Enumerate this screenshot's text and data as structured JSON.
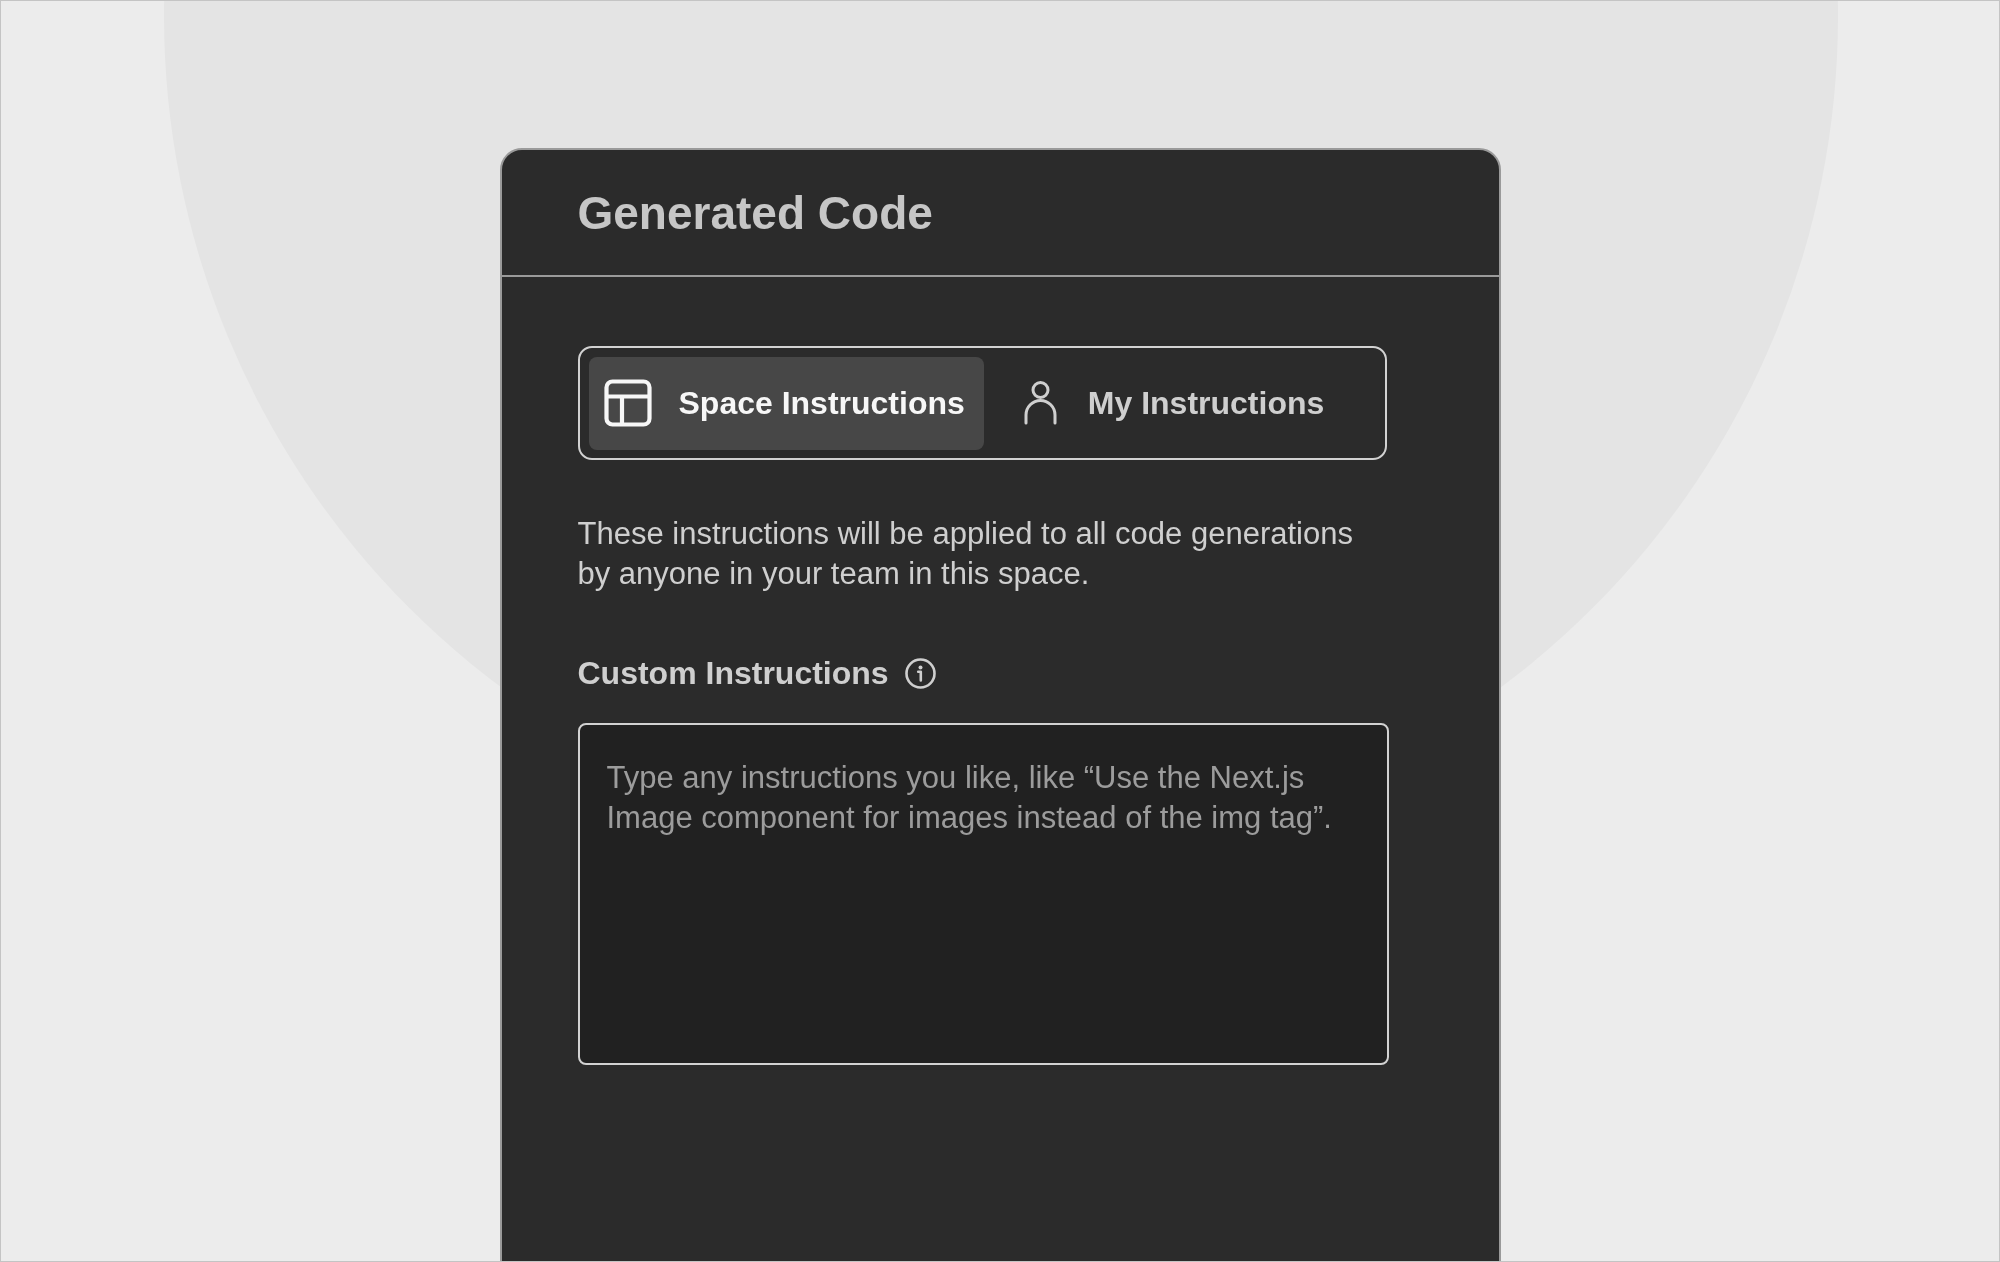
{
  "panel": {
    "title": "Generated Code"
  },
  "tabs": [
    {
      "label": "Space Instructions",
      "selected": true
    },
    {
      "label": "My Instructions",
      "selected": false
    }
  ],
  "description": "These instructions will be applied to all code generations by anyone in your team in this space.",
  "custom_instructions": {
    "label": "Custom Instructions",
    "placeholder": "Type any instructions you like, like “Use the Next.js Image component for images instead of the img tag”."
  }
}
